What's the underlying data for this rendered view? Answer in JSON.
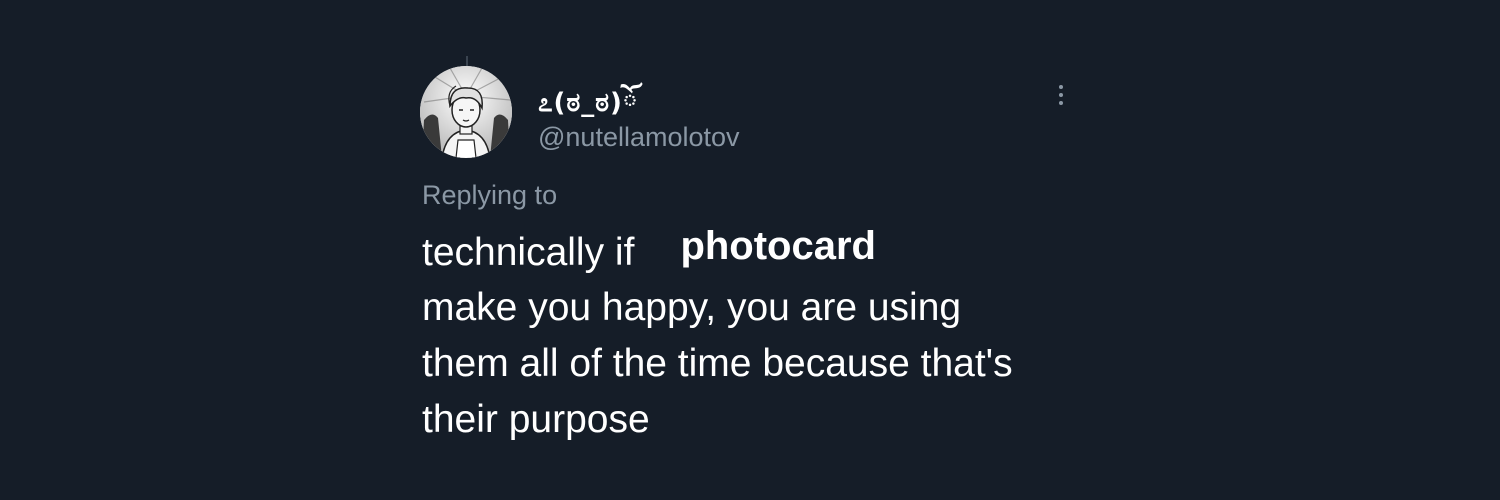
{
  "tweet": {
    "display_name": "೭(ಠ_ಠ)ོ",
    "handle": "@nutellamolotov",
    "replying_to": "Replying to",
    "lines": [
      "technically if",
      "make you happy, you are using",
      "them all of the time because that's",
      "their purpose"
    ],
    "overlay_label": "photocard",
    "avatar_icon": "avatar-drawing-icon",
    "more_icon": "more-vertical-icon"
  },
  "colors": {
    "background": "#151d28",
    "text_primary": "#ffffff",
    "text_secondary": "#8b98a5"
  }
}
